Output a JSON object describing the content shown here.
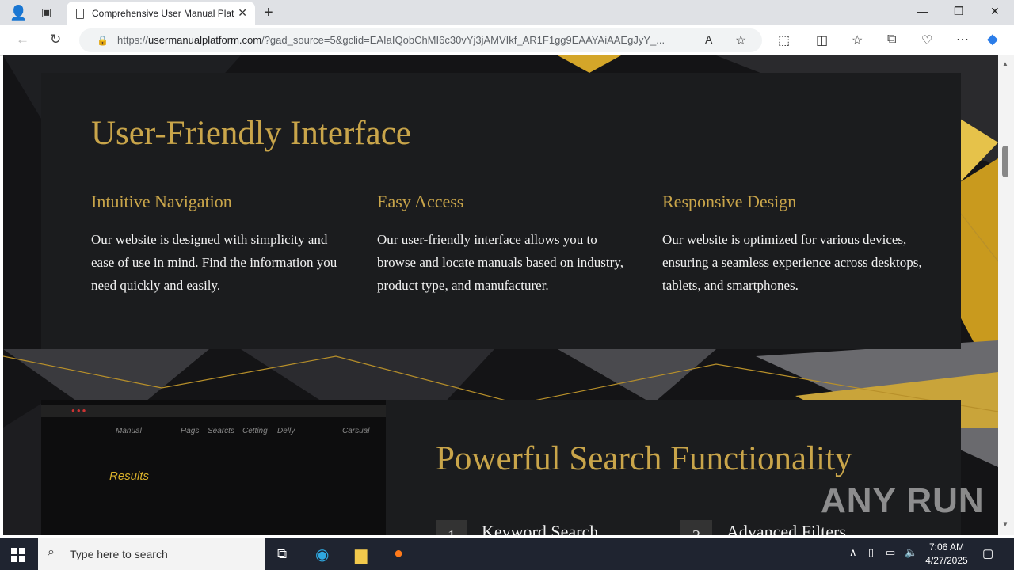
{
  "browser": {
    "tab_title": "Comprehensive User Manual Plat",
    "url_domain": "usermanualplatform.com",
    "url_prefix": "https://",
    "url_rest": "/?gad_source=5&gclid=EAIaIQobChMI6c30vYj3jAMVIkf_AR1F1gg9EAAYAiAAEgJyY_..."
  },
  "section1": {
    "heading": "User-Friendly Interface",
    "features": [
      {
        "title": "Intuitive Navigation",
        "text": "Our website is designed with simplicity and ease of use in mind. Find the information you need quickly and easily."
      },
      {
        "title": "Easy Access",
        "text": "Our user-friendly interface allows you to browse and locate manuals based on industry, product type, and manufacturer."
      },
      {
        "title": "Responsive Design",
        "text": "Our website is optimized for various devices, ensuring a seamless experience across desktops, tablets, and smartphones."
      }
    ]
  },
  "section2": {
    "heading": "Powerful Search Functionality",
    "image_menu": [
      "Manual",
      "Hags",
      "Searcts",
      "Cetting",
      "Delly",
      "Carsual"
    ],
    "image_results": "Results",
    "steps": [
      {
        "num": "1",
        "label": "Keyword Search"
      },
      {
        "num": "2",
        "label": "Advanced Filters"
      }
    ]
  },
  "watermark": "ANY RUN",
  "taskbar": {
    "search_placeholder": "Type here to search",
    "time": "7:06 AM",
    "date": "4/27/2025"
  },
  "colors": {
    "accent_gold": "#c9a54a",
    "card_bg": "#1b1c1e"
  }
}
